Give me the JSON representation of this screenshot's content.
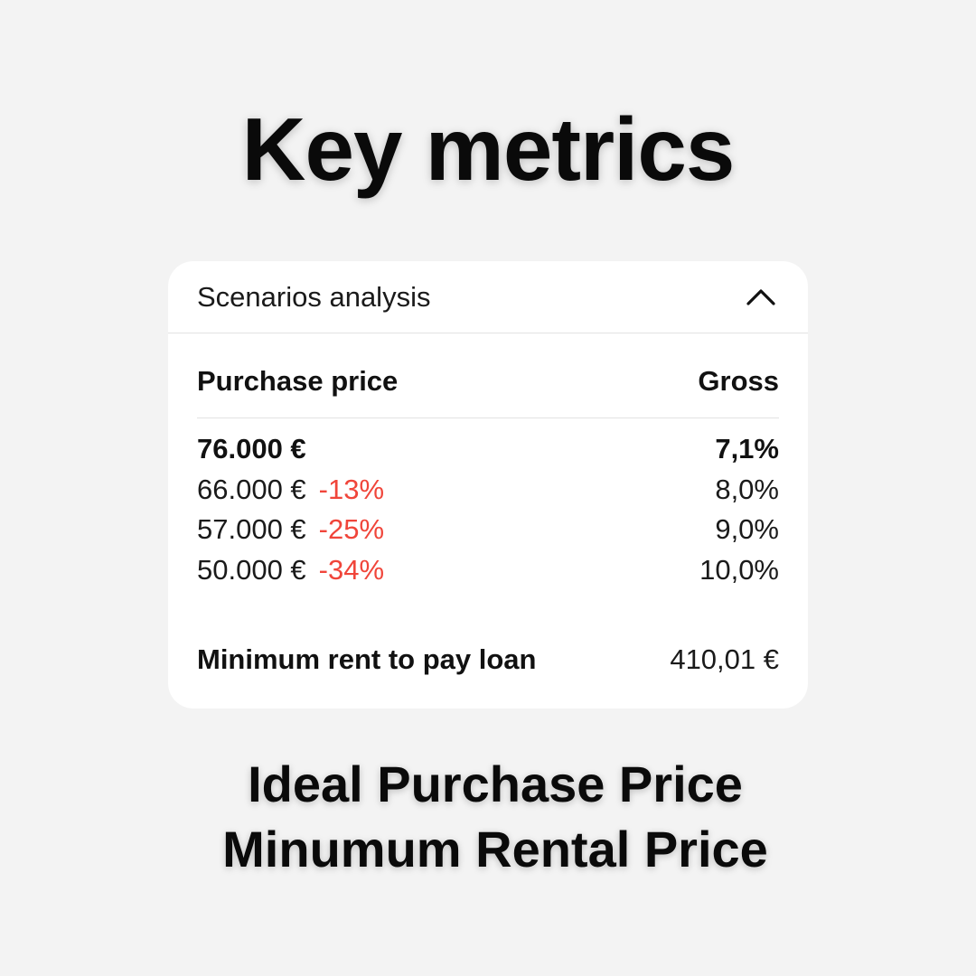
{
  "headline": "Key metrics",
  "card": {
    "title": "Scenarios analysis",
    "collapse_icon": "chevron-up-icon",
    "table": {
      "col_price": "Purchase price",
      "col_gross": "Gross",
      "rows": [
        {
          "price": "76.000 €",
          "change": "",
          "gross": "7,1%"
        },
        {
          "price": "66.000 €",
          "change": "-13%",
          "gross": "8,0%"
        },
        {
          "price": "57.000 €",
          "change": "-25%",
          "gross": "9,0%"
        },
        {
          "price": "50.000 €",
          "change": "-34%",
          "gross": "10,0%"
        }
      ]
    },
    "summary": {
      "label": "Minimum rent to pay loan",
      "value": "410,01 €"
    }
  },
  "footer": {
    "line1": "Ideal Purchase Price",
    "line2": "Minumum Rental Price"
  },
  "colors": {
    "negative_change": "#f0453a",
    "background": "#f3f3f3",
    "card": "#ffffff"
  }
}
